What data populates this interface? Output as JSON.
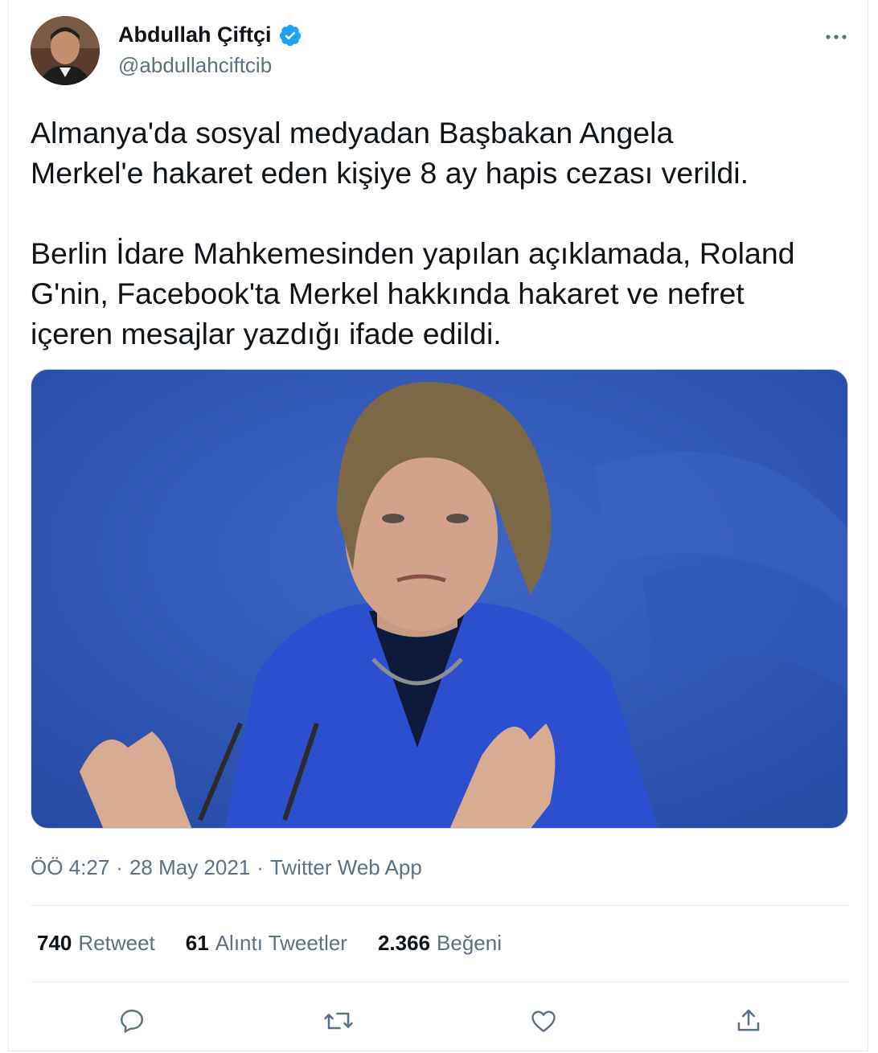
{
  "author": {
    "name": "Abdullah Çiftçi",
    "handle": "@abdullahciftcib",
    "verified_color": "#1da1f2"
  },
  "tweet": {
    "text": "Almanya'da sosyal medyadan Başbakan Angela\nMerkel'e hakaret eden kişiye 8 ay hapis cezası verildi.\n\nBerlin İdare Mahkemesinden yapılan açıklamada, Roland\nG'nin, Facebook'ta Merkel hakkında hakaret ve nefret\niçeren mesajlar yazdığı ifade edildi."
  },
  "meta": {
    "time": "ÖÖ 4:27",
    "date": "28 May 2021",
    "source": "Twitter Web App",
    "sep": "·"
  },
  "stats": [
    {
      "count": "740",
      "label": "Retweet"
    },
    {
      "count": "61",
      "label": "Alıntı Tweetler"
    },
    {
      "count": "2.366",
      "label": "Beğeni"
    }
  ],
  "icons": {
    "more": "more-icon",
    "reply": "reply-icon",
    "retweet": "retweet-icon",
    "like": "like-icon",
    "share": "share-icon"
  },
  "colors": {
    "text": "#0f1419",
    "secondary": "#5b7083",
    "image_background": "#2f56b8"
  }
}
